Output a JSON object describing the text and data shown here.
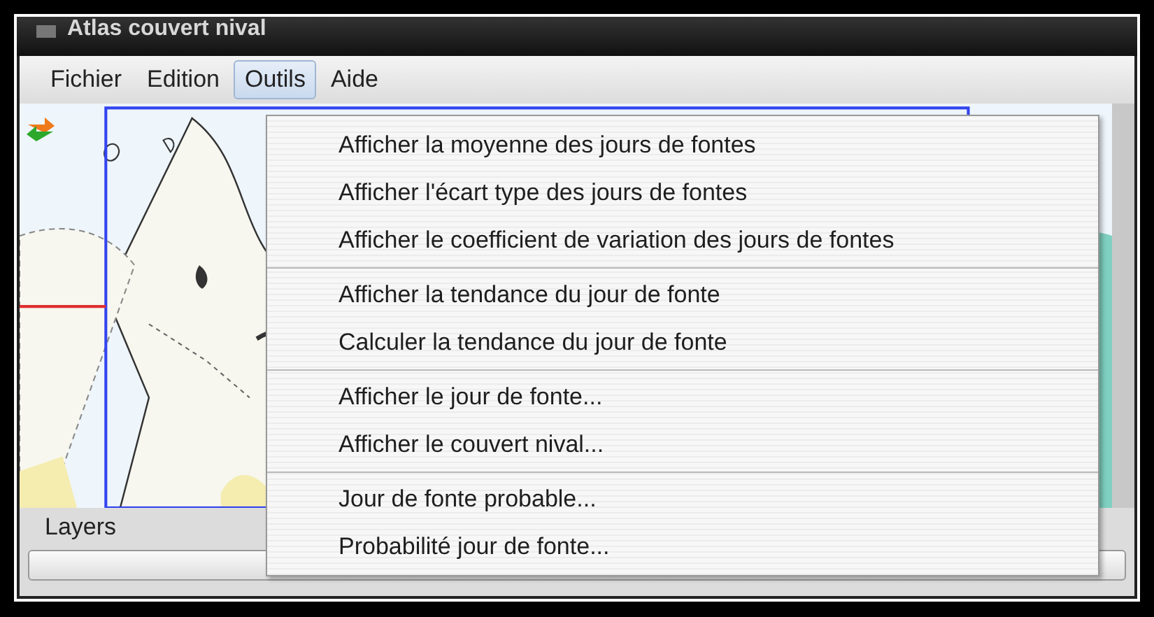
{
  "window": {
    "title": "Atlas couvert nival"
  },
  "menu_bar": [
    {
      "label": "Fichier",
      "selected": false
    },
    {
      "label": "Edition",
      "selected": false
    },
    {
      "label": "Outils",
      "selected": true
    },
    {
      "label": "Aide",
      "selected": false
    }
  ],
  "dropdown": {
    "groups": [
      [
        "Afficher la moyenne des jours de fontes",
        "Afficher l'écart type des jours de fontes",
        "Afficher le coefficient de variation des jours de fontes"
      ],
      [
        "Afficher la tendance du jour de fonte",
        "Calculer la tendance du jour de fonte"
      ],
      [
        "Afficher le jour de fonte...",
        "Afficher le couvert nival..."
      ],
      [
        "Jour de fonte probable...",
        "Probabilité jour de fonte..."
      ]
    ]
  },
  "layers_panel": {
    "title": "Layers"
  }
}
